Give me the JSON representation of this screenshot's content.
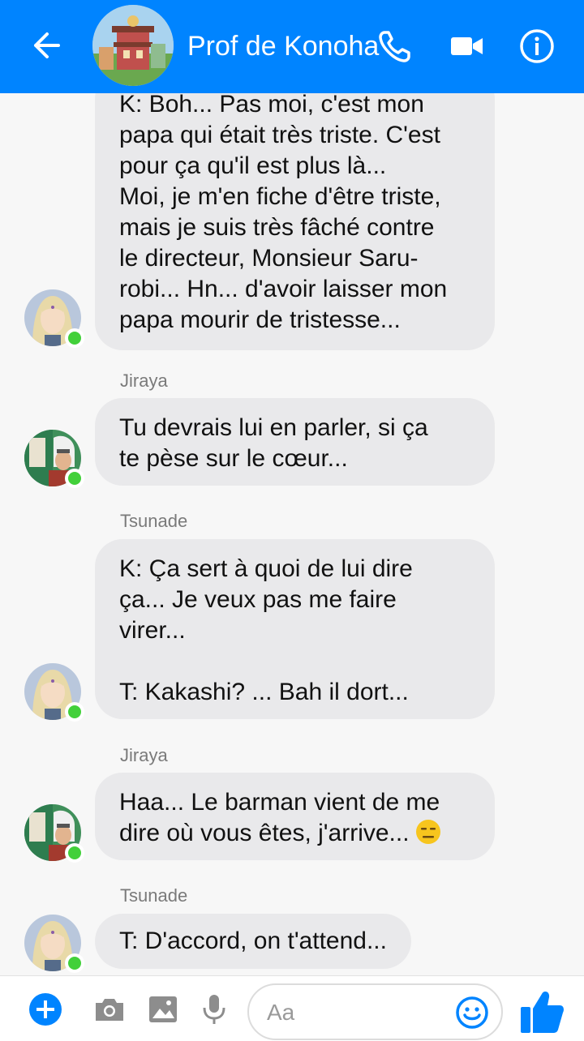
{
  "header": {
    "title": "Prof de Konoha",
    "back_icon": "arrow-left-icon",
    "call_icon": "phone-icon",
    "video_icon": "video-camera-icon",
    "info_icon": "info-icon"
  },
  "messages": [
    {
      "sender": "",
      "avatar": "tsunade",
      "text": "K: Boh... Pas moi, c'est mon\npapa qui était très triste. C'est\npour ça qu'il est plus là...\nMoi, je m'en fiche d'être triste,\nmais je suis très fâché contre\nle directeur, Monsieur Saru-\nrobi... Hn... d'avoir laisser mon\npapa mourir de tristesse..."
    },
    {
      "sender": "Jiraya",
      "avatar": "jiraya",
      "text": "Tu devrais lui en parler, si ça\nte pèse sur le cœur..."
    },
    {
      "sender": "Tsunade",
      "avatar": "tsunade",
      "text": "K: Ça sert à quoi de lui dire\nça... Je veux pas me faire\nvirer...\n\nT: Kakashi? ... Bah il dort..."
    },
    {
      "sender": "Jiraya",
      "avatar": "jiraya",
      "text_line1": "Haa... Le barman vient de me",
      "text_line2": "dire où vous êtes, j'arrive...",
      "emoji": "expressionless-face-icon"
    },
    {
      "sender": "Tsunade",
      "avatar": "tsunade",
      "text": "T: D'accord, on t'attend..."
    }
  ],
  "composer": {
    "placeholder": "Aa",
    "value": "",
    "icons": [
      "plus-icon",
      "camera-icon",
      "image-icon",
      "microphone-icon",
      "smiley-icon",
      "thumbs-up-icon"
    ]
  },
  "colors": {
    "header": "#0084ff",
    "bubble": "#e9e9eb",
    "online": "#42d03a",
    "background": "#f7f7f7"
  }
}
